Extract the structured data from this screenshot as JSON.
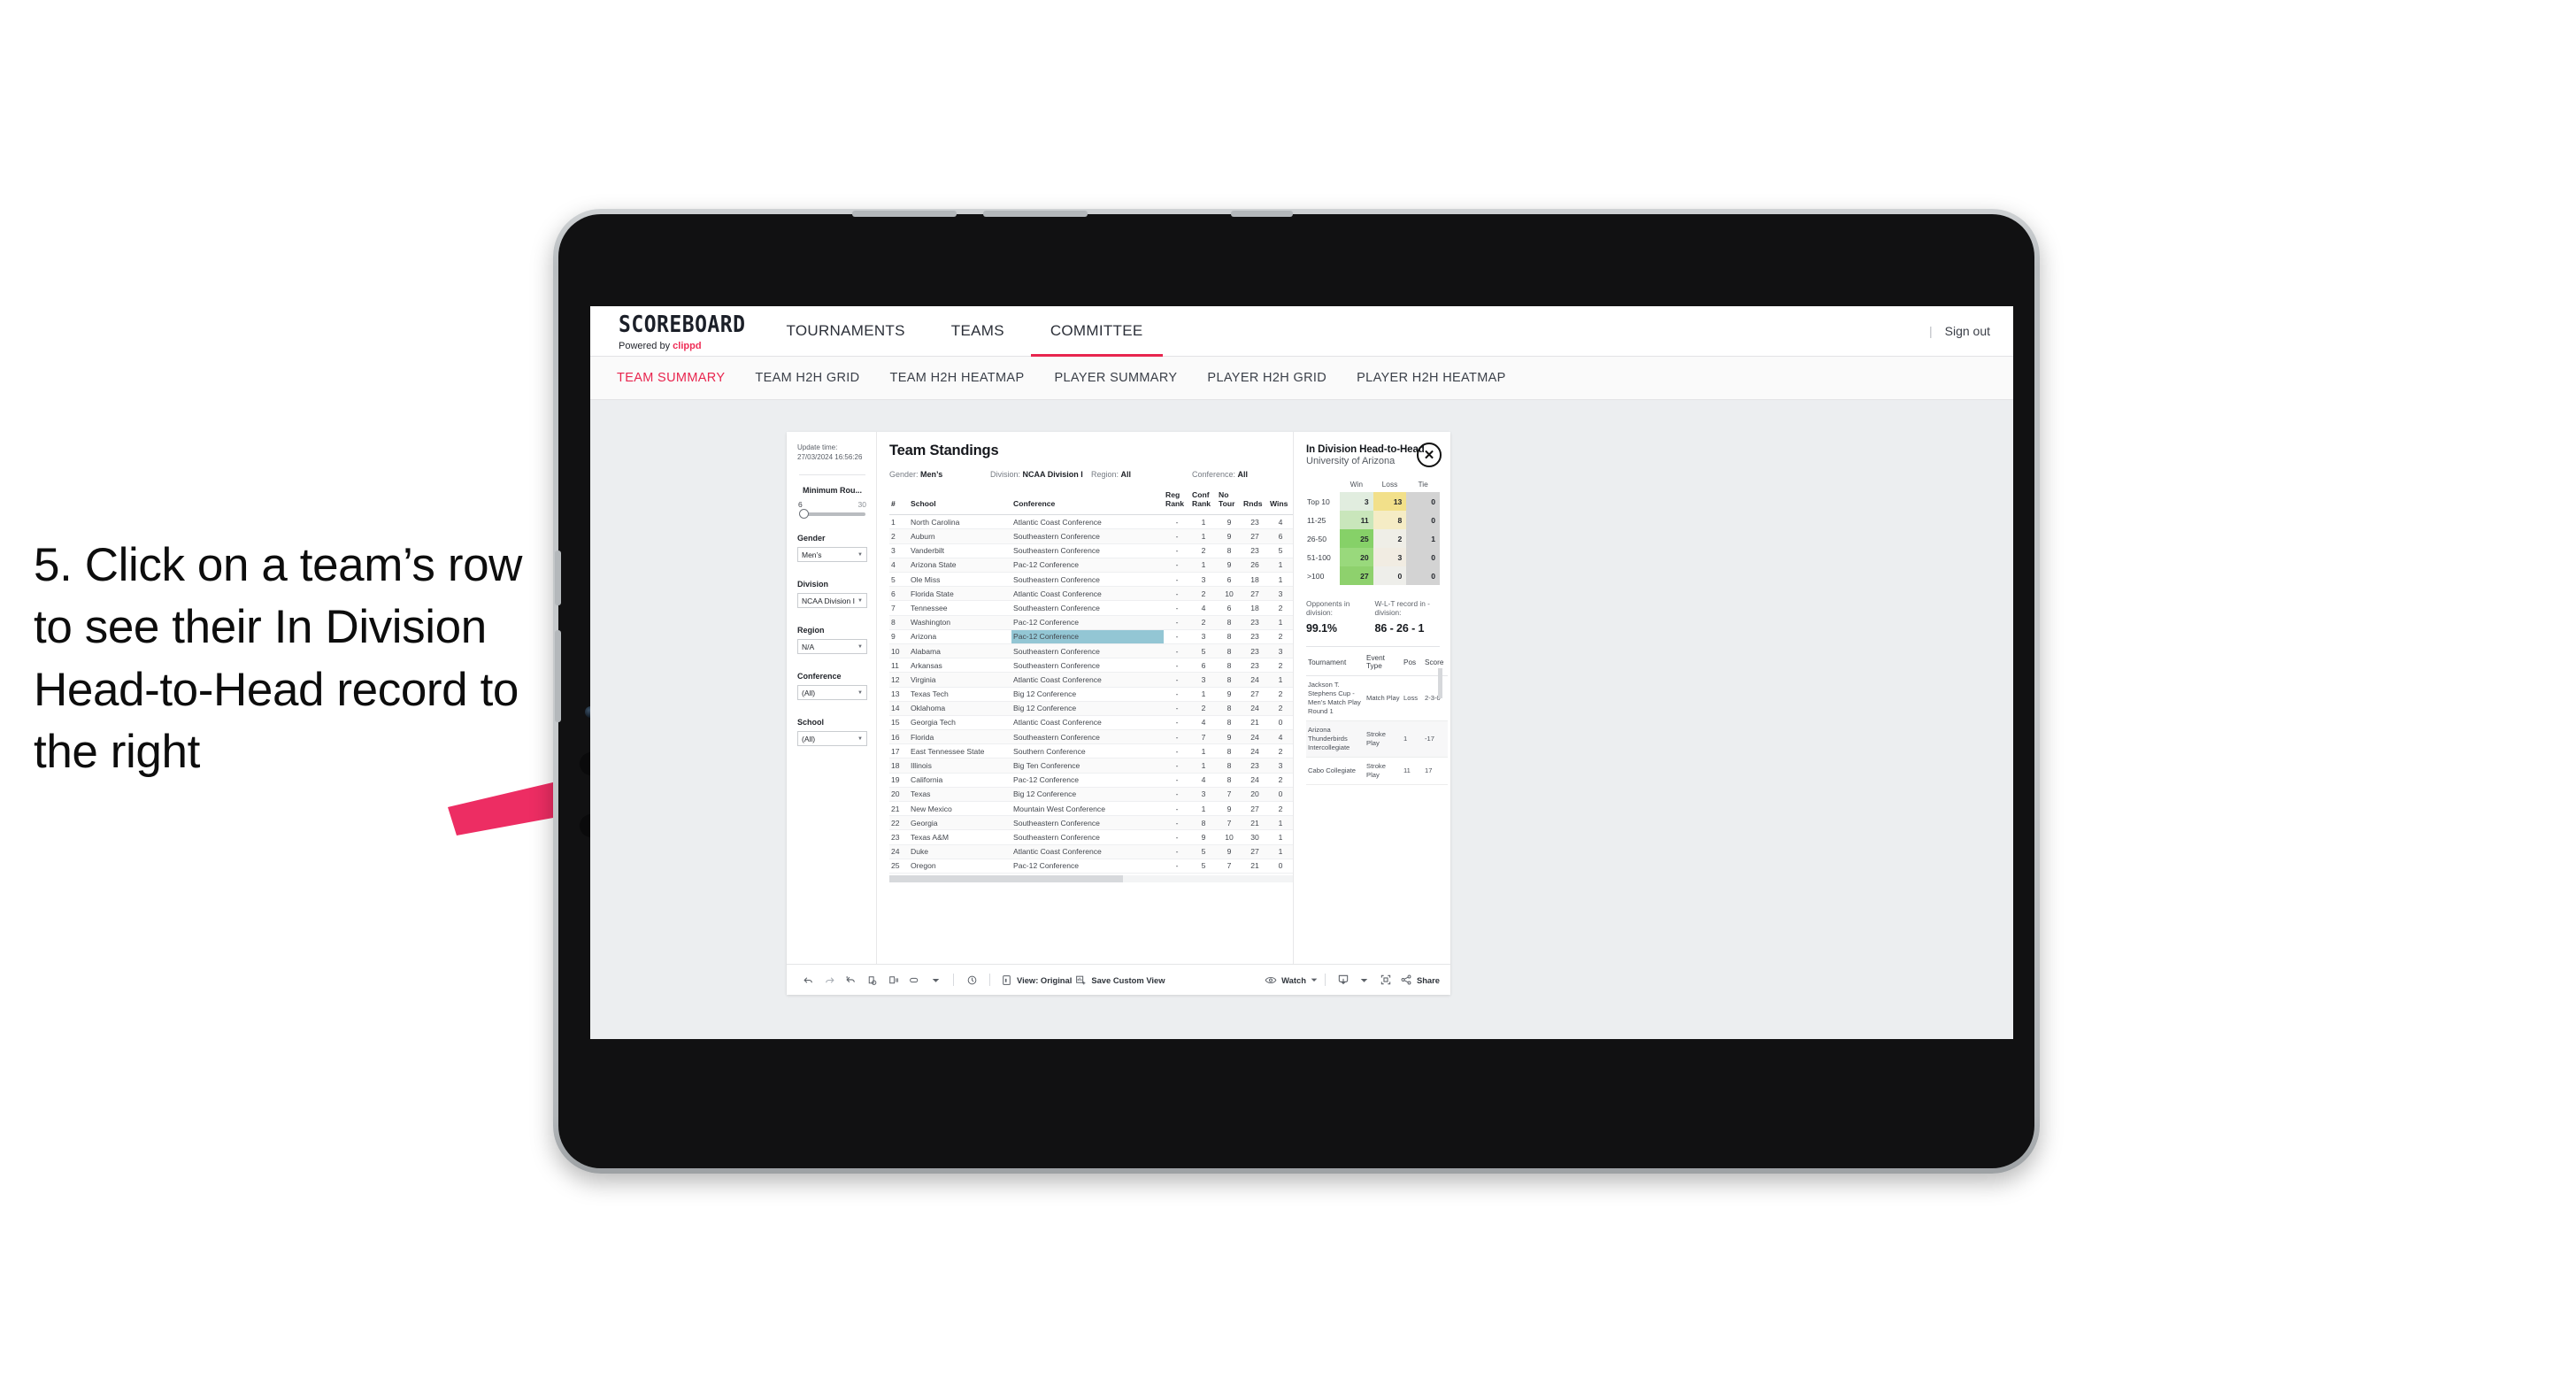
{
  "annotation": {
    "text": "5. Click on a team’s row to see their In Division Head-to-Head record to the right",
    "arrow_color": "#ed2d63"
  },
  "app": {
    "brand": {
      "name": "SCOREBOARD",
      "powered_prefix": "Powered by",
      "powered_brand": "clippd"
    },
    "nav": [
      {
        "label": "TOURNAMENTS",
        "active": false
      },
      {
        "label": "TEAMS",
        "active": false
      },
      {
        "label": "COMMITTEE",
        "active": true
      }
    ],
    "nav_right": {
      "separator": "|",
      "sign_out": "Sign out"
    },
    "subnav": [
      {
        "label": "TEAM SUMMARY",
        "active": true
      },
      {
        "label": "TEAM H2H GRID",
        "active": false
      },
      {
        "label": "TEAM H2H HEATMAP",
        "active": false
      },
      {
        "label": "PLAYER SUMMARY",
        "active": false
      },
      {
        "label": "PLAYER H2H GRID",
        "active": false
      },
      {
        "label": "PLAYER H2H HEATMAP",
        "active": false
      }
    ],
    "accent": "#e8254e"
  },
  "filters": {
    "update_time_label": "Update time:",
    "update_time_value": "27/03/2024 16:56:26",
    "min_rounds": {
      "label": "Minimum Rou...",
      "min": "6",
      "max": "30"
    },
    "gender": {
      "label": "Gender",
      "value": "Men’s"
    },
    "division": {
      "label": "Division",
      "value": "NCAA Division I"
    },
    "region": {
      "label": "Region",
      "value": "N/A"
    },
    "conference": {
      "label": "Conference",
      "value": "(All)"
    },
    "school": {
      "label": "School",
      "value": "(All)"
    }
  },
  "standings": {
    "title": "Team Standings",
    "summary": [
      {
        "key": "Gender:",
        "value": "Men’s"
      },
      {
        "key": "Division:",
        "value": "NCAA Division I"
      },
      {
        "key": "Region:",
        "value": "All"
      },
      {
        "key": "Conference:",
        "value": "All"
      }
    ],
    "columns": [
      "#",
      "School",
      "Conference",
      "Reg Rank",
      "Conf Rank",
      "No Tour",
      "Rnds",
      "Wins"
    ],
    "rows": [
      {
        "n": "1",
        "school": "North Carolina",
        "conf": "Atlantic Coast Conference",
        "reg": "-",
        "cr": "1",
        "nt": "9",
        "rnds": "23",
        "wins": "4",
        "sel": false
      },
      {
        "n": "2",
        "school": "Auburn",
        "conf": "Southeastern Conference",
        "reg": "-",
        "cr": "1",
        "nt": "9",
        "rnds": "27",
        "wins": "6",
        "sel": false
      },
      {
        "n": "3",
        "school": "Vanderbilt",
        "conf": "Southeastern Conference",
        "reg": "-",
        "cr": "2",
        "nt": "8",
        "rnds": "23",
        "wins": "5",
        "sel": false
      },
      {
        "n": "4",
        "school": "Arizona State",
        "conf": "Pac-12 Conference",
        "reg": "-",
        "cr": "1",
        "nt": "9",
        "rnds": "26",
        "wins": "1",
        "sel": false
      },
      {
        "n": "5",
        "school": "Ole Miss",
        "conf": "Southeastern Conference",
        "reg": "-",
        "cr": "3",
        "nt": "6",
        "rnds": "18",
        "wins": "1",
        "sel": false
      },
      {
        "n": "6",
        "school": "Florida State",
        "conf": "Atlantic Coast Conference",
        "reg": "-",
        "cr": "2",
        "nt": "10",
        "rnds": "27",
        "wins": "3",
        "sel": false
      },
      {
        "n": "7",
        "school": "Tennessee",
        "conf": "Southeastern Conference",
        "reg": "-",
        "cr": "4",
        "nt": "6",
        "rnds": "18",
        "wins": "2",
        "sel": false
      },
      {
        "n": "8",
        "school": "Washington",
        "conf": "Pac-12 Conference",
        "reg": "-",
        "cr": "2",
        "nt": "8",
        "rnds": "23",
        "wins": "1",
        "sel": false
      },
      {
        "n": "9",
        "school": "Arizona",
        "conf": "Pac-12 Conference",
        "reg": "-",
        "cr": "3",
        "nt": "8",
        "rnds": "23",
        "wins": "2",
        "sel": true
      },
      {
        "n": "10",
        "school": "Alabama",
        "conf": "Southeastern Conference",
        "reg": "-",
        "cr": "5",
        "nt": "8",
        "rnds": "23",
        "wins": "3",
        "sel": false
      },
      {
        "n": "11",
        "school": "Arkansas",
        "conf": "Southeastern Conference",
        "reg": "-",
        "cr": "6",
        "nt": "8",
        "rnds": "23",
        "wins": "2",
        "sel": false
      },
      {
        "n": "12",
        "school": "Virginia",
        "conf": "Atlantic Coast Conference",
        "reg": "-",
        "cr": "3",
        "nt": "8",
        "rnds": "24",
        "wins": "1",
        "sel": false
      },
      {
        "n": "13",
        "school": "Texas Tech",
        "conf": "Big 12 Conference",
        "reg": "-",
        "cr": "1",
        "nt": "9",
        "rnds": "27",
        "wins": "2",
        "sel": false
      },
      {
        "n": "14",
        "school": "Oklahoma",
        "conf": "Big 12 Conference",
        "reg": "-",
        "cr": "2",
        "nt": "8",
        "rnds": "24",
        "wins": "2",
        "sel": false
      },
      {
        "n": "15",
        "school": "Georgia Tech",
        "conf": "Atlantic Coast Conference",
        "reg": "-",
        "cr": "4",
        "nt": "8",
        "rnds": "21",
        "wins": "0",
        "sel": false
      },
      {
        "n": "16",
        "school": "Florida",
        "conf": "Southeastern Conference",
        "reg": "-",
        "cr": "7",
        "nt": "9",
        "rnds": "24",
        "wins": "4",
        "sel": false
      },
      {
        "n": "17",
        "school": "East Tennessee State",
        "conf": "Southern Conference",
        "reg": "-",
        "cr": "1",
        "nt": "8",
        "rnds": "24",
        "wins": "2",
        "sel": false
      },
      {
        "n": "18",
        "school": "Illinois",
        "conf": "Big Ten Conference",
        "reg": "-",
        "cr": "1",
        "nt": "8",
        "rnds": "23",
        "wins": "3",
        "sel": false
      },
      {
        "n": "19",
        "school": "California",
        "conf": "Pac-12 Conference",
        "reg": "-",
        "cr": "4",
        "nt": "8",
        "rnds": "24",
        "wins": "2",
        "sel": false
      },
      {
        "n": "20",
        "school": "Texas",
        "conf": "Big 12 Conference",
        "reg": "-",
        "cr": "3",
        "nt": "7",
        "rnds": "20",
        "wins": "0",
        "sel": false
      },
      {
        "n": "21",
        "school": "New Mexico",
        "conf": "Mountain West Conference",
        "reg": "-",
        "cr": "1",
        "nt": "9",
        "rnds": "27",
        "wins": "2",
        "sel": false
      },
      {
        "n": "22",
        "school": "Georgia",
        "conf": "Southeastern Conference",
        "reg": "-",
        "cr": "8",
        "nt": "7",
        "rnds": "21",
        "wins": "1",
        "sel": false
      },
      {
        "n": "23",
        "school": "Texas A&M",
        "conf": "Southeastern Conference",
        "reg": "-",
        "cr": "9",
        "nt": "10",
        "rnds": "30",
        "wins": "1",
        "sel": false
      },
      {
        "n": "24",
        "school": "Duke",
        "conf": "Atlantic Coast Conference",
        "reg": "-",
        "cr": "5",
        "nt": "9",
        "rnds": "27",
        "wins": "1",
        "sel": false
      },
      {
        "n": "25",
        "school": "Oregon",
        "conf": "Pac-12 Conference",
        "reg": "-",
        "cr": "5",
        "nt": "7",
        "rnds": "21",
        "wins": "0",
        "sel": false
      }
    ]
  },
  "h2h": {
    "title": "In Division Head-to-Head",
    "subtitle": "University of Arizona",
    "close_icon": "✕",
    "heatmap": {
      "columns": [
        "Win",
        "Loss",
        "Tie"
      ],
      "rows": [
        {
          "label": "Top 10",
          "win": "3",
          "loss": "13",
          "tie": "0",
          "win_color": "#e1eddf",
          "loss_color": "#f2e08a",
          "tie_color": "#d3d3d3"
        },
        {
          "label": "11-25",
          "win": "11",
          "loss": "8",
          "tie": "0",
          "win_color": "#c9e6bb",
          "loss_color": "#f5ecc5",
          "tie_color": "#d3d3d3"
        },
        {
          "label": "26-50",
          "win": "25",
          "loss": "2",
          "tie": "1",
          "win_color": "#86d168",
          "loss_color": "#efeee7",
          "tie_color": "#d3d3d3"
        },
        {
          "label": "51-100",
          "win": "20",
          "loss": "3",
          "tie": "0",
          "win_color": "#99d97c",
          "loss_color": "#f1ece2",
          "tie_color": "#d3d3d3"
        },
        {
          "label": ">100",
          "win": "27",
          "loss": "0",
          "tie": "0",
          "win_color": "#8ed16d",
          "loss_color": "#eeeeea",
          "tie_color": "#d3d3d3"
        }
      ]
    },
    "stats": [
      {
        "key": "Opponents in division:",
        "value": "99.1%"
      },
      {
        "key": "W-L-T record in -division:",
        "value": "86 - 26 - 1"
      }
    ],
    "tournaments": {
      "columns": [
        "Tournament",
        "Event Type",
        "Pos",
        "Score"
      ],
      "rows": [
        {
          "tournament": "Jackson T. Stephens Cup - Men’s Match Play Round 1",
          "event": "Match Play",
          "pos": "Loss",
          "score": "2-3-0"
        },
        {
          "tournament": "Arizona Thunderbirds Intercollegiate",
          "event": "Stroke Play",
          "pos": "1",
          "score": "-17"
        },
        {
          "tournament": "Cabo Collegiate",
          "event": "Stroke Play",
          "pos": "11",
          "score": "17"
        }
      ]
    }
  },
  "toolbar": {
    "view_label": "View: Original",
    "save_label": "Save Custom View",
    "watch_label": "Watch",
    "share_label": "Share"
  },
  "chart_data": {
    "type": "heatmap",
    "title": "In Division Head-to-Head — University of Arizona",
    "xlabel": "",
    "ylabel": "",
    "categories": [
      "Win",
      "Loss",
      "Tie"
    ],
    "rows": [
      "Top 10",
      "11-25",
      "26-50",
      "51-100",
      ">100"
    ],
    "values": [
      [
        3,
        13,
        0
      ],
      [
        11,
        8,
        0
      ],
      [
        25,
        2,
        1
      ],
      [
        20,
        3,
        0
      ],
      [
        27,
        0,
        0
      ]
    ],
    "totals": {
      "wins": 86,
      "losses": 26,
      "ties": 1,
      "opponents_in_division_pct": 99.1
    }
  }
}
